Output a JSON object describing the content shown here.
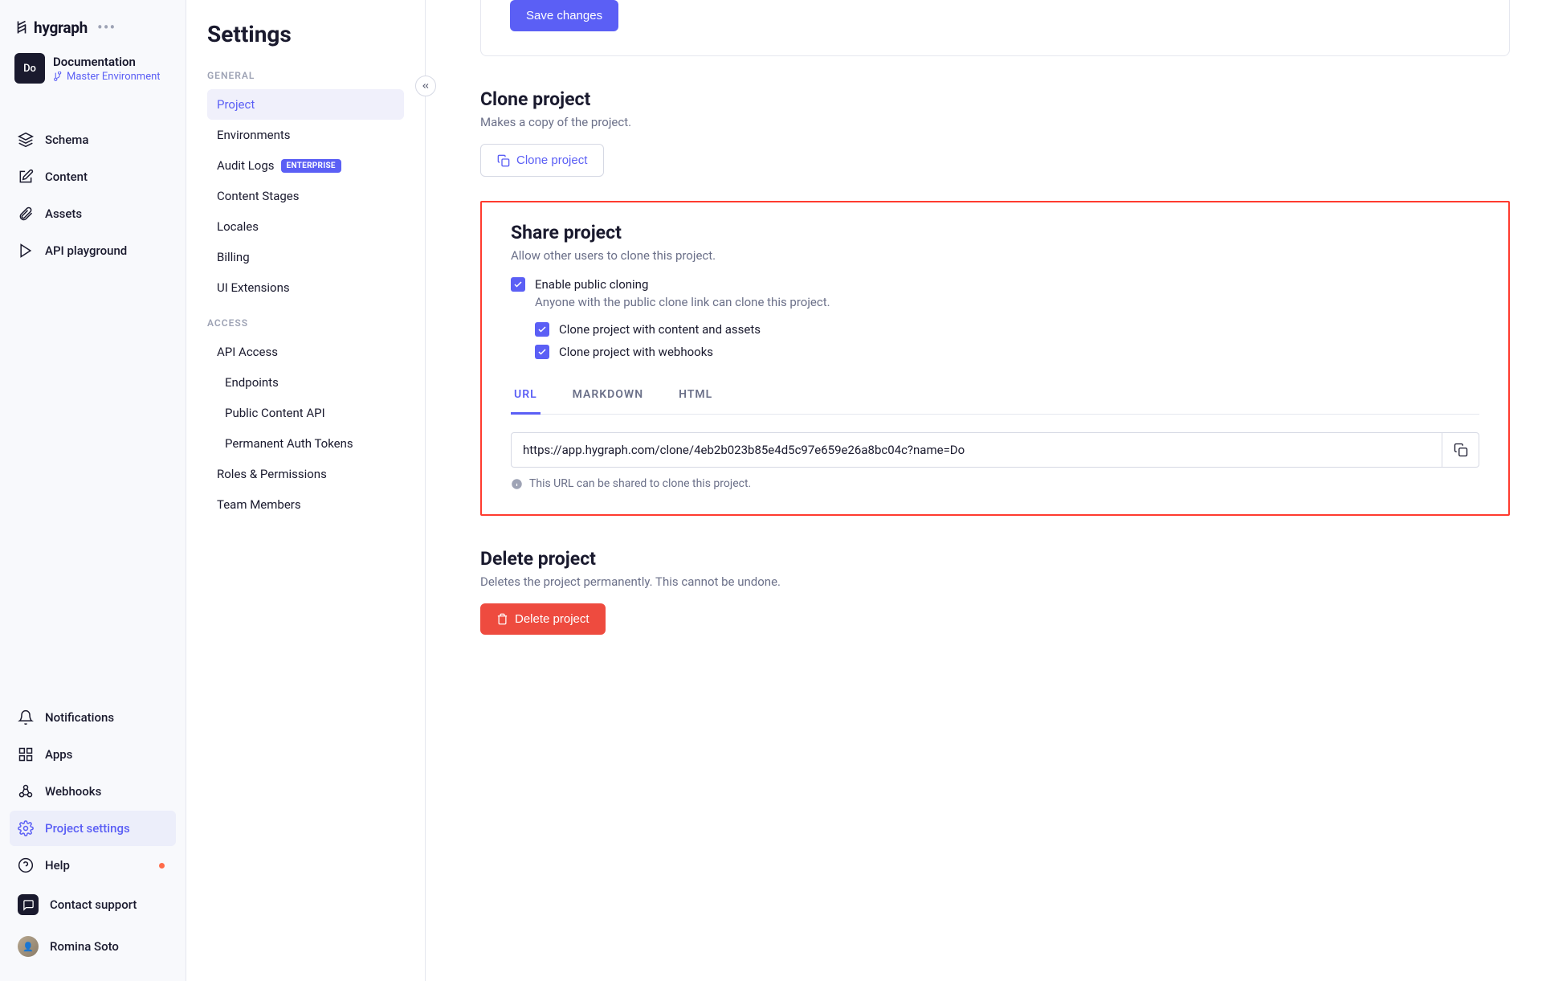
{
  "brand": {
    "name": "hygraph"
  },
  "project": {
    "badge": "Do",
    "name": "Documentation",
    "env": "Master Environment"
  },
  "primaryNav": {
    "schema": "Schema",
    "content": "Content",
    "assets": "Assets",
    "playground": "API playground",
    "notifications": "Notifications",
    "apps": "Apps",
    "webhooks": "Webhooks",
    "settings": "Project settings",
    "help": "Help",
    "support": "Contact support",
    "user": "Romina Soto"
  },
  "settingsPanel": {
    "title": "Settings",
    "general": {
      "heading": "GENERAL",
      "project": "Project",
      "environments": "Environments",
      "auditLogs": "Audit Logs",
      "enterpriseBadge": "ENTERPRISE",
      "contentStages": "Content Stages",
      "locales": "Locales",
      "billing": "Billing",
      "uiExtensions": "UI Extensions"
    },
    "access": {
      "heading": "ACCESS",
      "apiAccess": "API Access",
      "endpoints": "Endpoints",
      "publicContentApi": "Public Content API",
      "permAuthTokens": "Permanent Auth Tokens",
      "rolesPerms": "Roles & Permissions",
      "teamMembers": "Team Members"
    }
  },
  "main": {
    "saveChanges": "Save changes",
    "clone": {
      "title": "Clone project",
      "desc": "Makes a copy of the project.",
      "button": "Clone project"
    },
    "share": {
      "title": "Share project",
      "desc": "Allow other users to clone this project.",
      "enableLabel": "Enable public cloning",
      "enableDesc": "Anyone with the public clone link can clone this project.",
      "withContent": "Clone project with content and assets",
      "withWebhooks": "Clone project with webhooks",
      "tabs": {
        "url": "URL",
        "markdown": "MARKDOWN",
        "html": "HTML"
      },
      "urlValue": "https://app.hygraph.com/clone/4eb2b023b85e4d5c97e659e26a8bc04c?name=Do",
      "urlHint": "This URL can be shared to clone this project."
    },
    "delete": {
      "title": "Delete project",
      "desc": "Deletes the project permanently. This cannot be undone.",
      "button": "Delete project"
    }
  }
}
